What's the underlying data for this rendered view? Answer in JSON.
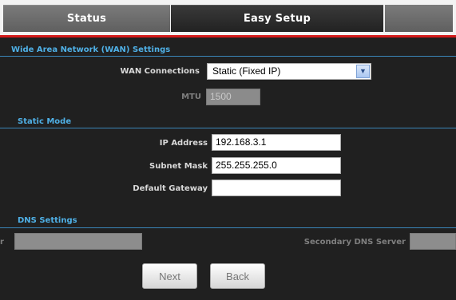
{
  "tabs": [
    {
      "label": "Status"
    },
    {
      "label": "Easy Setup"
    }
  ],
  "wan": {
    "section_title": "Wide Area Network (WAN) Settings",
    "connections_label": "WAN Connections",
    "connections_value": "Static (Fixed IP)",
    "mtu_label": "MTU",
    "mtu_value": "1500"
  },
  "static_mode": {
    "section_title": "Static Mode",
    "ip_label": "IP Address",
    "ip_value": "192.168.3.1",
    "subnet_label": "Subnet Mask",
    "subnet_value": "255.255.255.0",
    "gateway_label": "Default Gateway",
    "gateway_value": ""
  },
  "dns": {
    "section_title": "DNS Settings",
    "primary_label_fragment": "r",
    "primary_value": "",
    "secondary_label": "Secondary DNS Server",
    "secondary_value": ""
  },
  "buttons": {
    "next_label": "Next",
    "back_label": "Back"
  },
  "colors": {
    "accent_blue": "#4fb0e6",
    "tab_underline_red": "#d31a1a",
    "background": "#202020"
  },
  "icons": {
    "dropdown": "chevron-down-icon"
  }
}
